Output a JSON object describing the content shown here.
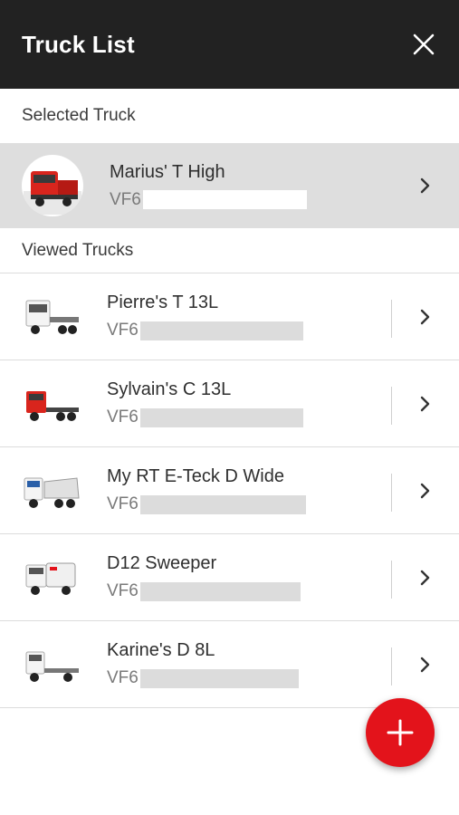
{
  "header": {
    "title": "Truck List"
  },
  "selected_section": {
    "label": "Selected Truck",
    "truck": {
      "name": "Marius' T High",
      "vin_prefix": "VF6",
      "color": "#d9251d"
    }
  },
  "viewed_section": {
    "label": "Viewed Trucks",
    "trucks": [
      {
        "name": "Pierre's T 13L",
        "vin_prefix": "VF6",
        "color": "#ffffff"
      },
      {
        "name": "Sylvain's C 13L",
        "vin_prefix": "VF6",
        "color": "#d9251d"
      },
      {
        "name": "My RT E-Teck D Wide",
        "vin_prefix": "VF6",
        "color": "#ffffff"
      },
      {
        "name": "D12 Sweeper",
        "vin_prefix": "VF6",
        "color": "#ffffff"
      },
      {
        "name": "Karine's D 8L",
        "vin_prefix": "VF6",
        "color": "#ffffff"
      }
    ]
  },
  "fab": {
    "icon": "plus-icon",
    "color": "#e3131b"
  },
  "icons": {
    "close": "close-icon",
    "chevron": "chevron-right-icon",
    "truck": "truck-icon"
  }
}
